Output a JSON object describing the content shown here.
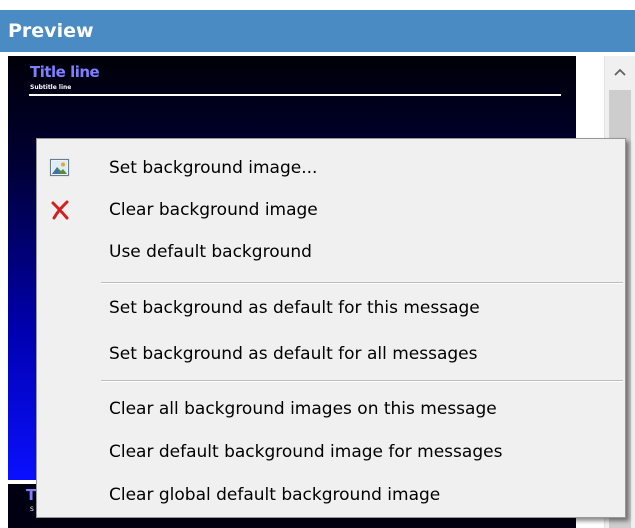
{
  "header": {
    "title": "Preview"
  },
  "preview": {
    "title": "Title line",
    "subtitle": "Subtitle line",
    "strip_title": "T",
    "strip_subtitle": "S"
  },
  "scrollbar": {
    "up_arrow": "^"
  },
  "context_menu": {
    "items": [
      {
        "label": "Set background image...",
        "icon": "picture-icon"
      },
      {
        "label": "Clear background image",
        "icon": "red-x-icon"
      },
      {
        "label": "Use default background",
        "icon": ""
      },
      {
        "label": "Set background as default for this message",
        "icon": ""
      },
      {
        "label": "Set background as default for all messages",
        "icon": ""
      },
      {
        "label": "Clear all background images on this message",
        "icon": ""
      },
      {
        "label": "Clear default background image for messages",
        "icon": ""
      },
      {
        "label": "Clear global default background image",
        "icon": ""
      }
    ]
  },
  "colors": {
    "header_bg": "#4a8bc3",
    "menu_bg": "#f0f0f0",
    "clear_icon": "#d42020",
    "preview_title": "#7f7fff"
  }
}
